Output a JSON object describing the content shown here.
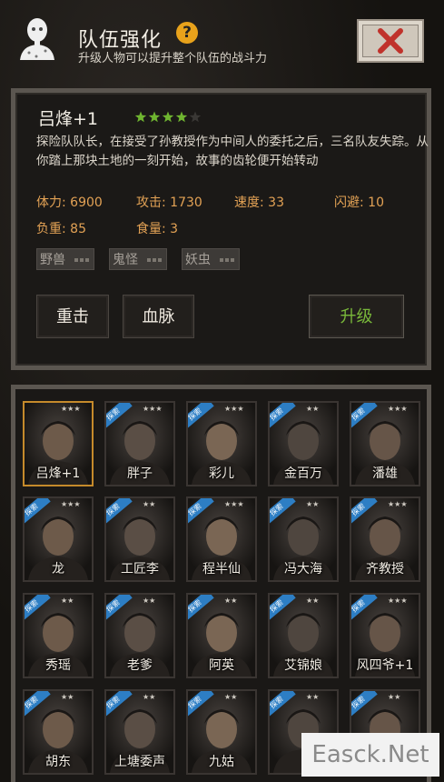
{
  "header": {
    "title": "队伍强化",
    "help_icon": "question-icon",
    "help_symbol": "?",
    "subtitle": "升级人物可以提升整个队伍的战斗力",
    "close_icon": "close-icon"
  },
  "character": {
    "name": "吕烽+1",
    "star_rating": 4,
    "star_max": 5,
    "description": "探险队队长，在接受了孙教授作为中间人的委托之后，三名队友失踪。从你踏上那块土地的一刻开始，故事的齿轮便开始转动",
    "stats": {
      "hp": "体力: 6900",
      "attack": "攻击: 1730",
      "speed": "速度: 33",
      "dodge": "闪避: 10",
      "load": "负重: 85",
      "food": "食量: 3"
    },
    "tags": [
      "野兽",
      "鬼怪",
      "妖虫"
    ],
    "skills": [
      "重击",
      "血脉"
    ],
    "upgrade_label": "升级"
  },
  "roster": {
    "badge_text": "探索",
    "characters": [
      {
        "name": "吕烽+1",
        "stars": "★★★",
        "selected": true,
        "badge": false
      },
      {
        "name": "胖子",
        "stars": "★★★",
        "selected": false,
        "badge": true
      },
      {
        "name": "彩儿",
        "stars": "★★★",
        "selected": false,
        "badge": true
      },
      {
        "name": "金百万",
        "stars": "★★",
        "selected": false,
        "badge": true
      },
      {
        "name": "潘雄",
        "stars": "★★★",
        "selected": false,
        "badge": true
      },
      {
        "name": "龙",
        "stars": "★★★",
        "selected": false,
        "badge": true
      },
      {
        "name": "工匠李",
        "stars": "★★",
        "selected": false,
        "badge": true
      },
      {
        "name": "程半仙",
        "stars": "★★★",
        "selected": false,
        "badge": true
      },
      {
        "name": "冯大海",
        "stars": "★★",
        "selected": false,
        "badge": true
      },
      {
        "name": "齐教授",
        "stars": "★★★",
        "selected": false,
        "badge": true
      },
      {
        "name": "秀瑶",
        "stars": "★★",
        "selected": false,
        "badge": true
      },
      {
        "name": "老爹",
        "stars": "★★",
        "selected": false,
        "badge": true
      },
      {
        "name": "阿英",
        "stars": "★★",
        "selected": false,
        "badge": true
      },
      {
        "name": "艾锦娘",
        "stars": "★★",
        "selected": false,
        "badge": true
      },
      {
        "name": "风四爷+1",
        "stars": "★★★",
        "selected": false,
        "badge": true
      },
      {
        "name": "胡东",
        "stars": "★★",
        "selected": false,
        "badge": true
      },
      {
        "name": "上塘委声",
        "stars": "★★",
        "selected": false,
        "badge": true
      },
      {
        "name": "九姑",
        "stars": "★★",
        "selected": false,
        "badge": true
      },
      {
        "name": "",
        "stars": "★★",
        "selected": false,
        "badge": true
      },
      {
        "name": "",
        "stars": "★★",
        "selected": false,
        "badge": true
      }
    ]
  },
  "watermark": "Easck.Net",
  "colors": {
    "stat_orange": "#e3a255",
    "star_green": "#6fb530",
    "upgrade_green": "#79b83a",
    "help_yellow": "#e8a21b",
    "badge_blue": "#2d7ec4",
    "selected_border": "#c58a2b"
  }
}
